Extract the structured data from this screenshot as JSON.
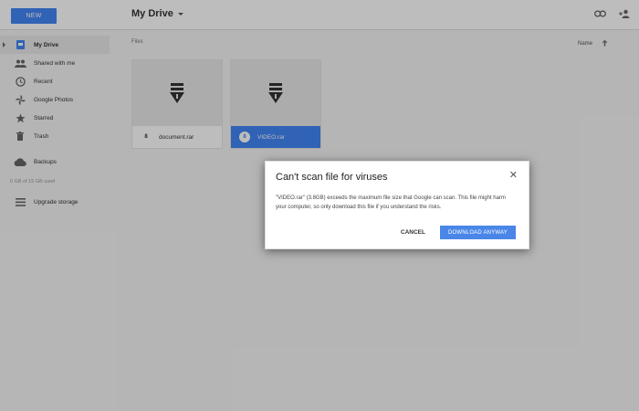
{
  "topbar": {
    "new_label": "NEW",
    "title": "My Drive"
  },
  "sidebar": {
    "items": [
      {
        "label": "My Drive",
        "icon": "drive-icon"
      },
      {
        "label": "Shared with me",
        "icon": "people-icon"
      },
      {
        "label": "Recent",
        "icon": "clock-icon"
      },
      {
        "label": "Google Photos",
        "icon": "pinwheel-icon"
      },
      {
        "label": "Starred",
        "icon": "star-icon"
      },
      {
        "label": "Trash",
        "icon": "trash-icon"
      },
      {
        "label": "Backups",
        "icon": "cloud-icon"
      }
    ],
    "storage": "0 GB of 15 GB used",
    "upgrade_label": "Upgrade storage"
  },
  "main": {
    "section_label": "Files",
    "sort_label": "Name",
    "files": [
      {
        "name": "document.rar",
        "badge": "8"
      },
      {
        "name": "VIDEO.rar",
        "badge": "8"
      }
    ]
  },
  "dialog": {
    "title": "Can't scan file for viruses",
    "body": "\"VIDEO.rar\" (3.8GB) exceeds the maximum file size that Google can scan. This file might harm your computer, so only download this file if you understand the risks.",
    "cancel_label": "CANCEL",
    "download_label": "DOWNLOAD ANYWAY"
  },
  "colors": {
    "accent": "#4285f4",
    "overlay": "rgba(0,0,0,0.26)"
  }
}
